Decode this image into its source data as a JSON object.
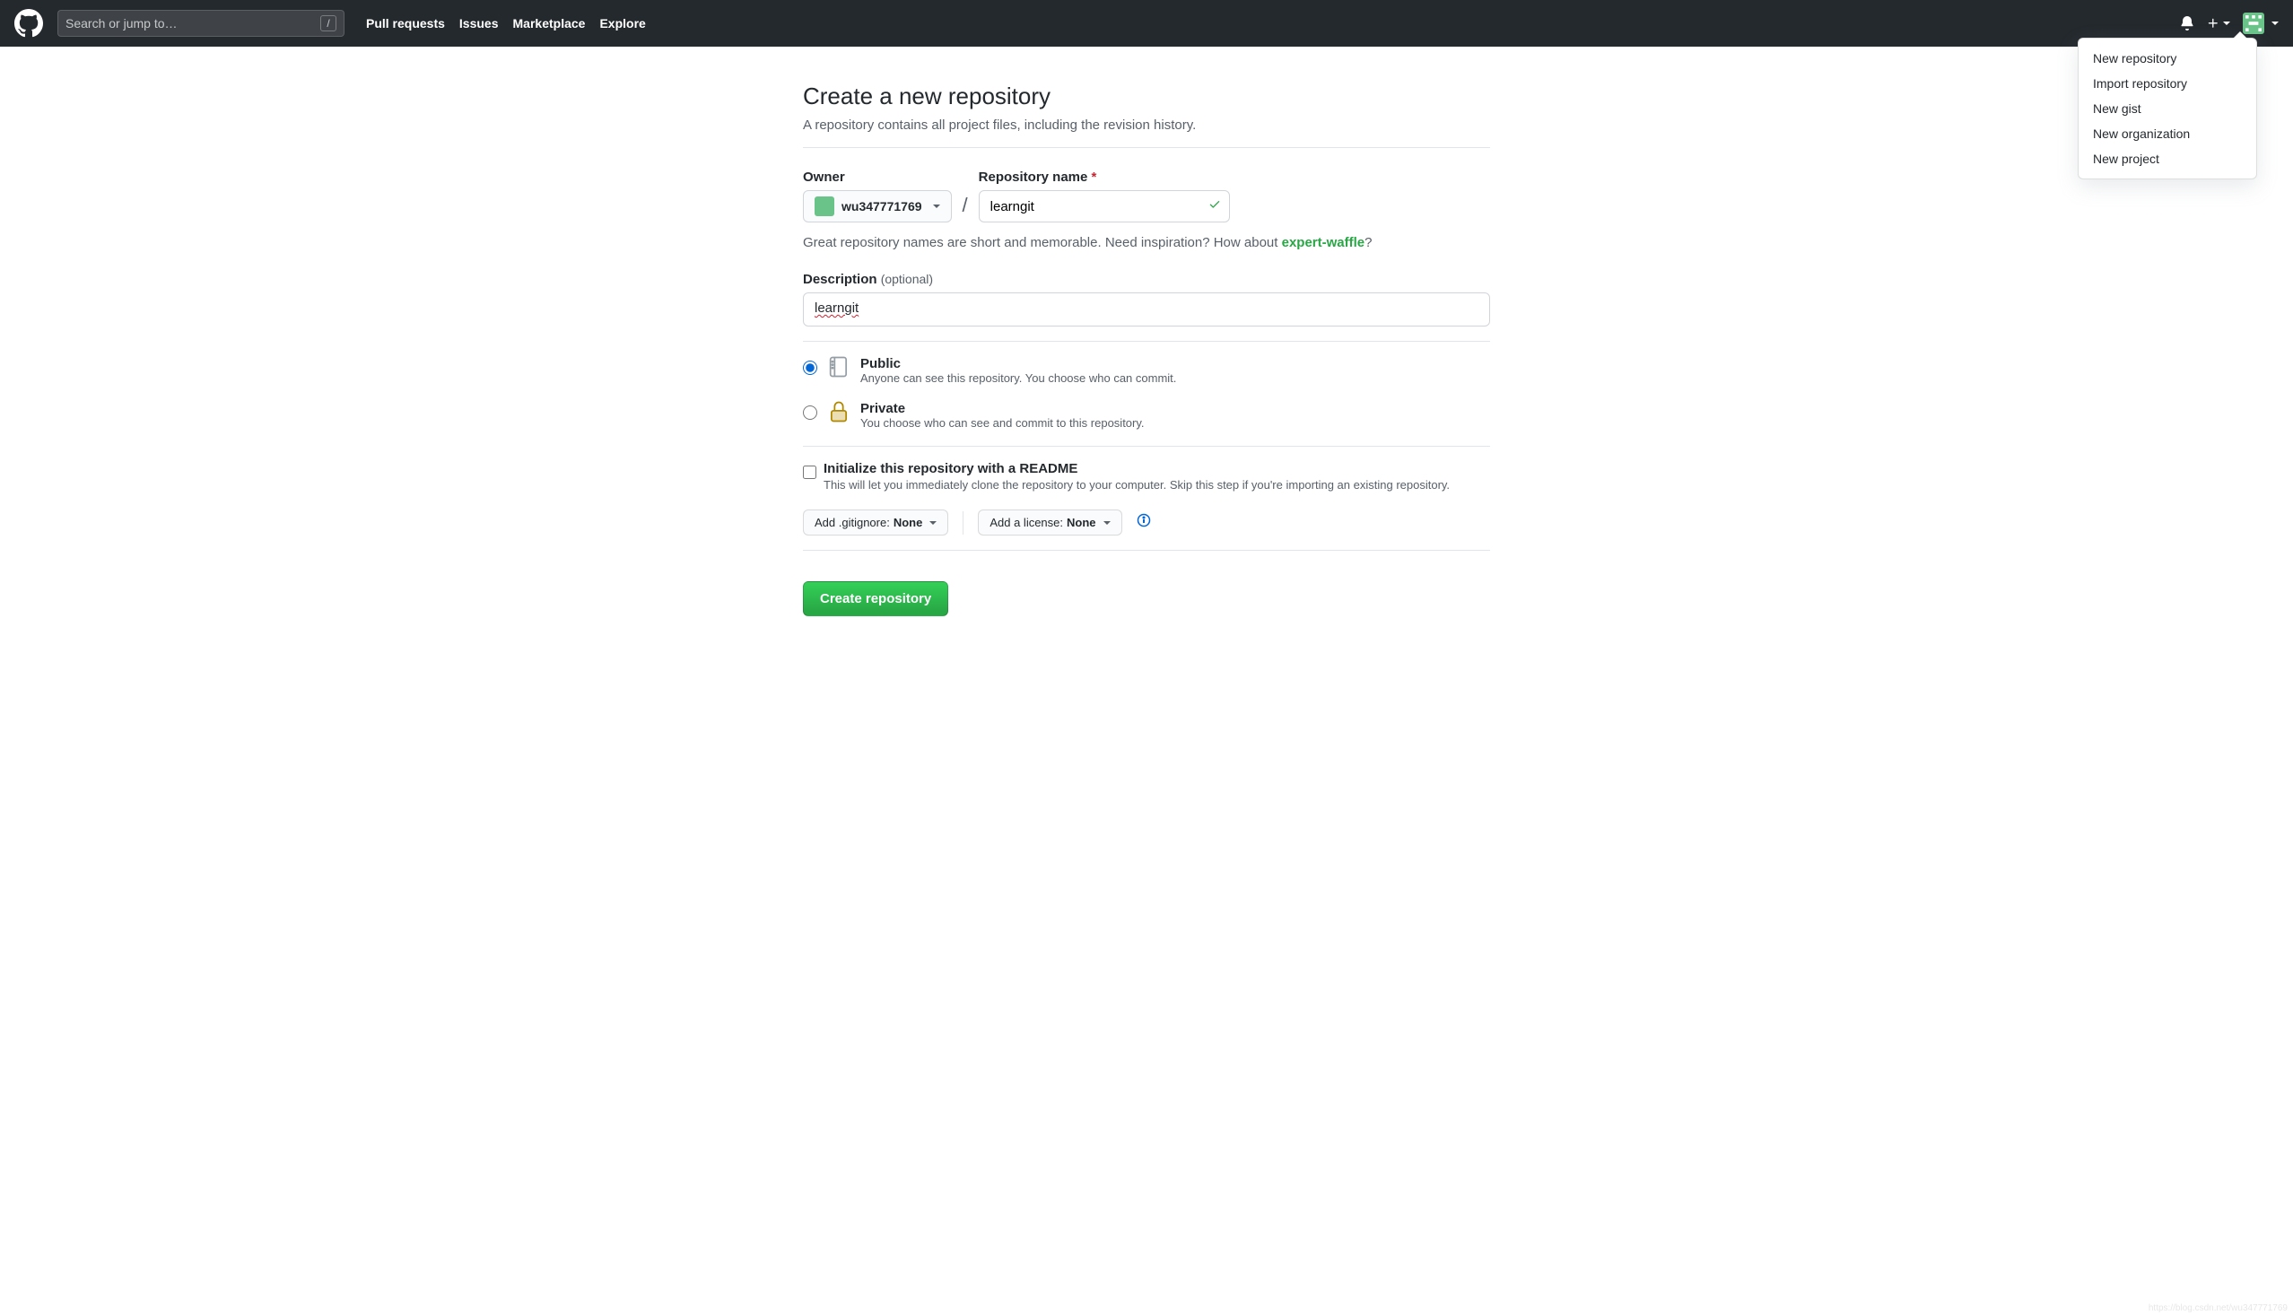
{
  "header": {
    "search_placeholder": "Search or jump to…",
    "search_shortcut": "/",
    "nav": [
      "Pull requests",
      "Issues",
      "Marketplace",
      "Explore"
    ]
  },
  "dropdown": {
    "items": [
      "New repository",
      "Import repository",
      "New gist",
      "New organization",
      "New project"
    ]
  },
  "page": {
    "title": "Create a new repository",
    "subtitle": "A repository contains all project files, including the revision history."
  },
  "form": {
    "owner_label": "Owner",
    "owner_value": "wu347771769",
    "repo_label": "Repository name",
    "repo_value": "learngit",
    "hint_prefix": "Great repository names are short and memorable. Need inspiration? How about ",
    "hint_suggestion": "expert-waffle",
    "hint_suffix": "?",
    "desc_label": "Description",
    "desc_optional": "(optional)",
    "desc_value": "learngit",
    "visibility": {
      "public_title": "Public",
      "public_desc": "Anyone can see this repository. You choose who can commit.",
      "private_title": "Private",
      "private_desc": "You choose who can see and commit to this repository."
    },
    "readme_title": "Initialize this repository with a README",
    "readme_desc": "This will let you immediately clone the repository to your computer. Skip this step if you're importing an existing repository.",
    "gitignore_label": "Add .gitignore:",
    "gitignore_value": "None",
    "license_label": "Add a license:",
    "license_value": "None",
    "submit": "Create repository"
  },
  "watermark": "https://blog.csdn.net/wu347771769"
}
